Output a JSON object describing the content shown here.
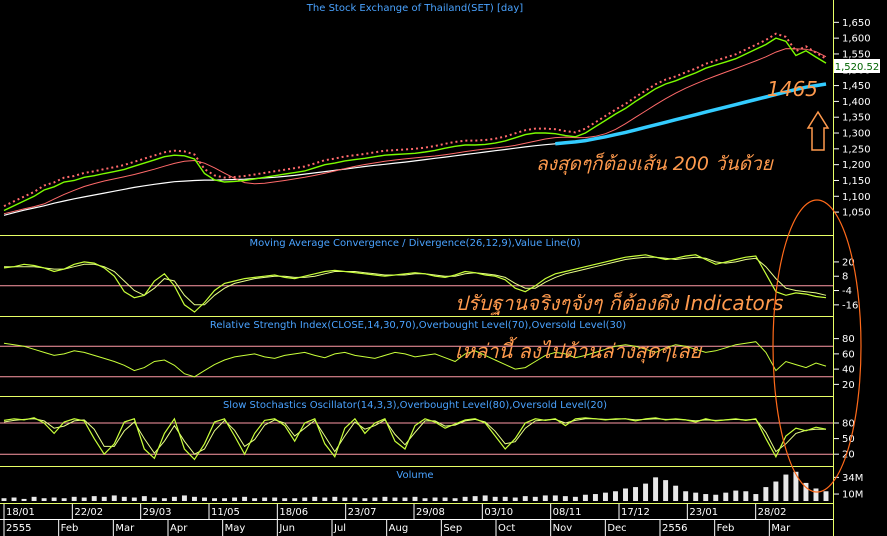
{
  "chart_data": [
    {
      "type": "line",
      "title": "The Stock Exchange of Thailand(SET) [day]",
      "y_ticks": [
        "1,650",
        "1,600",
        "1,550",
        "1,500",
        "1,450",
        "1,400",
        "1,350",
        "1,300",
        "1,250",
        "1,200",
        "1,150",
        "1,100",
        "1,050"
      ],
      "ylim": [
        1025,
        1670
      ],
      "last_value": "1,520.52",
      "x": [
        0,
        10,
        20,
        30,
        40,
        50,
        60,
        70,
        80,
        90,
        100,
        110,
        120,
        130,
        140,
        150,
        160,
        170,
        180,
        190,
        200,
        210,
        220,
        230,
        240,
        250,
        260,
        270,
        280,
        290,
        300,
        310,
        320,
        330,
        340,
        350,
        360,
        370,
        380,
        390,
        400,
        410,
        420,
        430,
        440,
        450,
        460,
        470,
        480,
        490,
        500,
        510,
        520,
        530,
        540,
        550,
        560,
        570,
        580,
        590,
        600,
        610,
        620,
        630,
        640,
        650,
        660,
        670,
        680,
        690,
        700,
        710,
        720,
        730,
        740,
        750,
        760,
        770,
        780,
        790,
        800,
        810,
        820
      ],
      "series": [
        {
          "role": "close",
          "values": [
            1055,
            1070,
            1085,
            1100,
            1120,
            1130,
            1145,
            1150,
            1160,
            1165,
            1172,
            1178,
            1185,
            1195,
            1205,
            1215,
            1225,
            1230,
            1228,
            1218,
            1172,
            1152,
            1145,
            1147,
            1150,
            1155,
            1160,
            1165,
            1170,
            1175,
            1180,
            1190,
            1200,
            1205,
            1212,
            1216,
            1220,
            1225,
            1230,
            1232,
            1234,
            1236,
            1240,
            1245,
            1252,
            1258,
            1262,
            1262,
            1264,
            1268,
            1275,
            1285,
            1295,
            1300,
            1300,
            1298,
            1292,
            1288,
            1300,
            1320,
            1340,
            1360,
            1378,
            1400,
            1420,
            1440,
            1455,
            1465,
            1478,
            1490,
            1505,
            1515,
            1525,
            1535,
            1550,
            1565,
            1580,
            1600,
            1590,
            1545,
            1560,
            1540,
            1521
          ]
        },
        {
          "role": "ma-200",
          "values": [
            1040,
            1048,
            1056,
            1063,
            1070,
            1078,
            1085,
            1092,
            1098,
            1104,
            1110,
            1116,
            1122,
            1128,
            1133,
            1138,
            1142,
            1146,
            1148,
            1150,
            1151,
            1151,
            1152,
            1153,
            1154,
            1156,
            1158,
            1160,
            1163,
            1166,
            1170,
            1174,
            1178,
            1182,
            1186,
            1190,
            1194,
            1198,
            1201,
            1205,
            1208,
            1212,
            1216,
            1220,
            1224,
            1228,
            1232,
            1236,
            1240,
            1244,
            1248,
            1252,
            1256,
            1260,
            1263,
            1266,
            1269,
            1272,
            1276,
            1282,
            1288,
            1295,
            1302,
            1310,
            1318,
            1326,
            1334,
            1342,
            1350,
            1358,
            1366,
            1374,
            1382,
            1390,
            1398,
            1406,
            1414,
            1422,
            1430,
            1438,
            1445,
            1450,
            1455
          ]
        }
      ],
      "annotations": [
        "1465",
        "ลงสุดๆก็ต้องเส้น 200 วันด้วย"
      ]
    },
    {
      "type": "line",
      "title": "Moving Average Convergence / Divergence(26,12,9),Value Line(0)",
      "y_ticks": [
        "20",
        "8",
        "-4",
        "-16"
      ],
      "ylim": [
        -22,
        30
      ],
      "series": [
        {
          "role": "macd",
          "values": [
            15,
            16,
            18,
            17,
            15,
            12,
            14,
            18,
            20,
            19,
            15,
            8,
            -5,
            -10,
            -8,
            4,
            10,
            0,
            -16,
            -22,
            -14,
            -4,
            2,
            4,
            6,
            7,
            8,
            9,
            7,
            6,
            8,
            10,
            12,
            13,
            12,
            11,
            10,
            9,
            8,
            9,
            10,
            11,
            10,
            8,
            7,
            9,
            12,
            11,
            9,
            8,
            5,
            -2,
            -5,
            0,
            6,
            10,
            12,
            14,
            16,
            18,
            20,
            22,
            24,
            25,
            26,
            24,
            22,
            23,
            25,
            26,
            22,
            18,
            20,
            22,
            24,
            25,
            10,
            -5,
            -8,
            -6,
            -7,
            -9,
            -10
          ]
        },
        {
          "role": "signal",
          "values": [
            16,
            16,
            16,
            16,
            15,
            14,
            14,
            16,
            18,
            18,
            16,
            12,
            4,
            -4,
            -8,
            -2,
            6,
            4,
            -8,
            -16,
            -16,
            -8,
            -2,
            2,
            4,
            6,
            7,
            8,
            8,
            7,
            7,
            8,
            10,
            12,
            12,
            12,
            11,
            10,
            9,
            9,
            9,
            10,
            10,
            9,
            8,
            8,
            10,
            11,
            10,
            9,
            7,
            2,
            -2,
            -2,
            3,
            7,
            10,
            12,
            14,
            16,
            18,
            20,
            22,
            23,
            24,
            24,
            23,
            22,
            23,
            24,
            23,
            20,
            19,
            20,
            22,
            23,
            16,
            6,
            -2,
            -4,
            -5,
            -6,
            -8
          ]
        }
      ],
      "annotations": [
        "ปรับฐานจริงๆจังๆ ก็ต้องดึง Indicators"
      ]
    },
    {
      "type": "line",
      "title": "Relative Strength Index(CLOSE,14,30,70),Overbought Level(70),Oversold Level(30)",
      "y_ticks": [
        "80",
        "60",
        "40",
        "20"
      ],
      "ylim": [
        10,
        90
      ],
      "reference_levels": [
        70,
        30
      ],
      "series": [
        {
          "role": "rsi",
          "values": [
            74,
            72,
            70,
            66,
            62,
            58,
            60,
            64,
            62,
            58,
            54,
            50,
            45,
            38,
            42,
            50,
            52,
            45,
            34,
            30,
            38,
            46,
            52,
            56,
            58,
            60,
            56,
            54,
            58,
            60,
            62,
            58,
            55,
            60,
            62,
            58,
            56,
            54,
            58,
            62,
            60,
            56,
            58,
            60,
            55,
            50,
            60,
            64,
            58,
            52,
            46,
            40,
            42,
            50,
            58,
            62,
            60,
            55,
            58,
            62,
            66,
            70,
            72,
            70,
            66,
            62,
            68,
            72,
            70,
            66,
            62,
            64,
            68,
            72,
            74,
            76,
            62,
            38,
            50,
            46,
            42,
            48,
            44
          ]
        }
      ],
      "annotations": [
        "เหล่านี้ ลงไปด้านล่างสุดๆเลย"
      ]
    },
    {
      "type": "line",
      "title": "Slow Stochastics Oscillator(14,3,3),Overbought Level(80),Oversold Level(20)",
      "y_ticks": [
        "80",
        "50",
        "20"
      ],
      "ylim": [
        5,
        105
      ],
      "reference_levels": [
        80,
        20
      ],
      "series": [
        {
          "role": "k",
          "values": [
            85,
            88,
            86,
            90,
            80,
            60,
            82,
            88,
            84,
            50,
            20,
            40,
            82,
            88,
            30,
            12,
            60,
            88,
            30,
            10,
            40,
            82,
            88,
            55,
            20,
            60,
            85,
            88,
            75,
            45,
            80,
            88,
            40,
            15,
            70,
            88,
            60,
            80,
            88,
            45,
            30,
            75,
            88,
            82,
            70,
            78,
            86,
            88,
            80,
            55,
            30,
            50,
            80,
            88,
            85,
            88,
            75,
            88,
            90,
            88,
            86,
            88,
            88,
            84,
            88,
            90,
            86,
            88,
            86,
            82,
            88,
            84,
            86,
            88,
            85,
            88,
            50,
            15,
            55,
            70,
            65,
            72,
            68
          ]
        },
        {
          "role": "d",
          "values": [
            82,
            85,
            87,
            88,
            84,
            70,
            74,
            84,
            86,
            68,
            35,
            35,
            65,
            82,
            50,
            22,
            45,
            75,
            45,
            20,
            30,
            65,
            85,
            66,
            35,
            48,
            76,
            86,
            80,
            55,
            70,
            85,
            55,
            25,
            55,
            82,
            68,
            75,
            86,
            58,
            38,
            62,
            84,
            84,
            74,
            76,
            84,
            87,
            82,
            64,
            40,
            44,
            70,
            84,
            86,
            87,
            80,
            85,
            88,
            88,
            87,
            87,
            88,
            86,
            87,
            88,
            87,
            87,
            86,
            84,
            86,
            85,
            86,
            87,
            86,
            87,
            62,
            25,
            40,
            60,
            66,
            68,
            68
          ]
        }
      ]
    },
    {
      "type": "bar",
      "title": "Volume",
      "y_ticks": [
        "34M",
        "10M"
      ],
      "ylim": [
        0,
        46
      ],
      "values": [
        4,
        5,
        3,
        6,
        4,
        5,
        4,
        6,
        5,
        7,
        6,
        8,
        6,
        5,
        7,
        5,
        4,
        6,
        8,
        6,
        5,
        4,
        4,
        5,
        6,
        4,
        5,
        5,
        4,
        4,
        5,
        6,
        5,
        6,
        5,
        5,
        4,
        5,
        6,
        5,
        5,
        6,
        4,
        5,
        5,
        4,
        6,
        7,
        8,
        6,
        6,
        5,
        7,
        6,
        8,
        8,
        7,
        6,
        9,
        10,
        12,
        14,
        18,
        20,
        25,
        34,
        30,
        22,
        14,
        12,
        10,
        9,
        12,
        15,
        14,
        10,
        20,
        28,
        38,
        42,
        26,
        18,
        14
      ]
    }
  ],
  "x_axis": {
    "row1": [
      "18/01",
      "22/02",
      "29/03",
      "11/05",
      "18/06",
      "23/07",
      "29/08",
      "03/10",
      "08/11",
      "17/12",
      "23/01",
      "28/02"
    ],
    "row2": [
      "2555",
      "Feb",
      "Mar",
      "Apr",
      "May",
      "Jun",
      "Jul",
      "Aug",
      "Sep",
      "Oct",
      "Nov",
      "Dec",
      "2556",
      "Feb",
      "Mar"
    ]
  },
  "colors": {
    "background": "#000000",
    "price_line": "#7cfc00",
    "ma_short": "#ff6a6a",
    "ma_long": "#ffffff",
    "ma_200": "#33ccff",
    "indicator_main": "#c8ff3a",
    "indicator_signal": "#e8ff88",
    "ref_line": "#ff9aa6",
    "volume": "#e8e8e8",
    "annotation": "#ff9a4d",
    "title": "#4aa3ff"
  }
}
